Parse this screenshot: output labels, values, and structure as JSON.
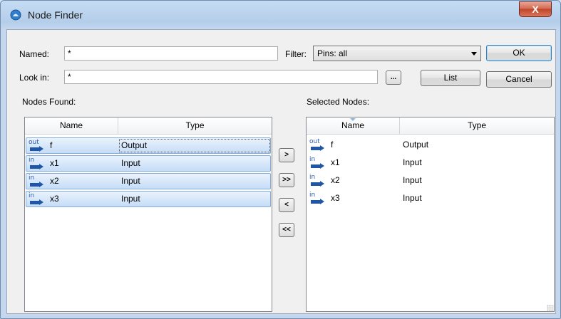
{
  "window": {
    "title": "Node Finder",
    "close_glyph": "X"
  },
  "named": {
    "label": "Named:",
    "value": "*"
  },
  "filter": {
    "label": "Filter:",
    "selected": "Pins: all"
  },
  "look_in": {
    "label": "Look in:",
    "value": "*",
    "browse_label": "..."
  },
  "buttons": {
    "ok": "OK",
    "list": "List",
    "cancel": "Cancel"
  },
  "nodes_found": {
    "label": "Nodes Found:",
    "columns": [
      "Name",
      "Type"
    ],
    "rows": [
      {
        "pin": "out",
        "name": "f",
        "type": "Output"
      },
      {
        "pin": "in",
        "name": "x1",
        "type": "Input"
      },
      {
        "pin": "in",
        "name": "x2",
        "type": "Input"
      },
      {
        "pin": "in",
        "name": "x3",
        "type": "Input"
      }
    ]
  },
  "transfer": {
    "add": ">",
    "add_all": ">>",
    "remove": "<",
    "remove_all": "<<"
  },
  "selected_nodes": {
    "label": "Selected Nodes:",
    "columns": [
      "Name",
      "Type"
    ],
    "rows": [
      {
        "pin": "out",
        "name": "f",
        "type": "Output"
      },
      {
        "pin": "in",
        "name": "x1",
        "type": "Input"
      },
      {
        "pin": "in",
        "name": "x2",
        "type": "Input"
      },
      {
        "pin": "in",
        "name": "x3",
        "type": "Input"
      }
    ]
  },
  "colors": {
    "pin_icon": "#1f56a6",
    "selection": "#c5dcf7",
    "close": "#c0452a"
  }
}
